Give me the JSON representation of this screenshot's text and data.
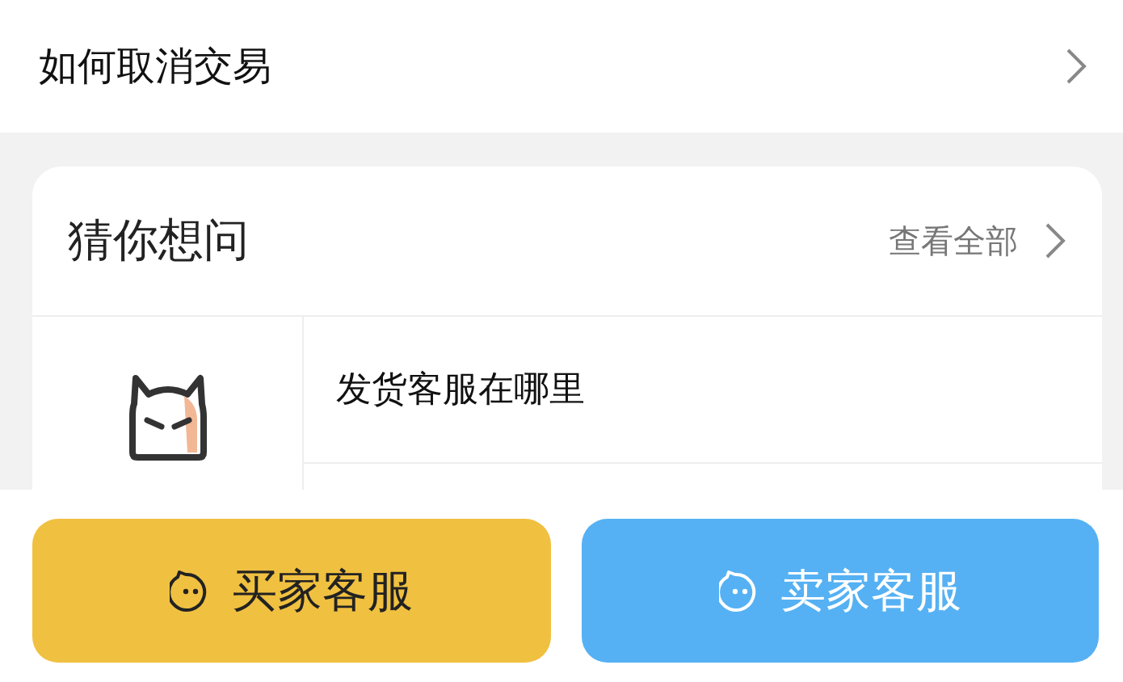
{
  "top_item": {
    "label": "如何取消交易"
  },
  "guess_card": {
    "title": "猜你想问",
    "view_all": "查看全部",
    "questions": [
      {
        "label": "发货客服在哪里"
      }
    ]
  },
  "buttons": [
    {
      "label": "买家客服",
      "color": "#f0c040"
    },
    {
      "label": "卖家客服",
      "color": "#55b1f3"
    }
  ]
}
